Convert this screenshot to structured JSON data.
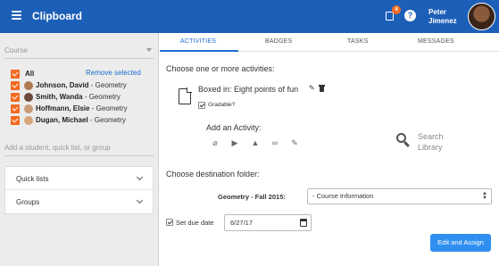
{
  "header": {
    "app_title": "Clipboard",
    "notification_count": "4",
    "help_label": "?",
    "user_first": "Peter",
    "user_last": "Jimenez"
  },
  "sidebar": {
    "course_placeholder": "Course",
    "all_label": "All",
    "remove_selected": "Remove selected",
    "students": [
      {
        "last_first": "Johnson, David",
        "course": " - Geometry"
      },
      {
        "last_first": "Smith, Wanda",
        "course": " - Geometry"
      },
      {
        "last_first": "Hoffmann, Elsie",
        "course": " - Geometry"
      },
      {
        "last_first": "Dugan, Michael",
        "course": " - Geometry"
      }
    ],
    "add_placeholder": "Add a student, quick list, or group",
    "panels": [
      {
        "label": "Quick lists"
      },
      {
        "label": "Groups"
      }
    ]
  },
  "tabs": [
    {
      "label": "ACTIVITIES"
    },
    {
      "label": "BADGES"
    },
    {
      "label": "TASKS"
    },
    {
      "label": "MESSAGES"
    }
  ],
  "main": {
    "choose_activities": "Choose one or more activities:",
    "activity_title": "Boxed in: Eight points of fun",
    "gradable_label": "Gradable?",
    "add_activity": "Add an Activity:",
    "activity_icons": [
      "paperclip-icon",
      "youtube-icon",
      "google-drive-icon",
      "link-icon",
      "pencil-icon"
    ],
    "search_library_line1": "Search",
    "search_library_line2": "Library",
    "choose_folder": "Choose destination folder:",
    "folder_course": "Geometry - Fall 2015:",
    "folder_value": "- Course Information",
    "set_due_label": "Set due date",
    "due_date": "6/27/17",
    "edit_assign": "Edit and Assign"
  },
  "colors": {
    "brand_blue": "#1c5fb8",
    "accent_orange": "#f26a21",
    "link_blue": "#1c6fd1",
    "button_blue": "#2f8ff0"
  }
}
